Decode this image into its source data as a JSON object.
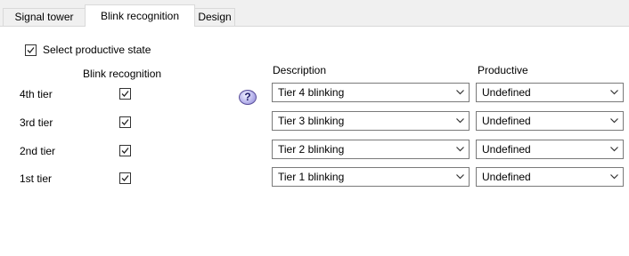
{
  "tabs": [
    {
      "label": "Signal tower"
    },
    {
      "label": "Blink recognition"
    },
    {
      "label": "Design"
    }
  ],
  "select_productive": {
    "label": "Select productive state",
    "checked": true
  },
  "columns": {
    "blink": "Blink recognition",
    "description": "Description",
    "productive": "Productive"
  },
  "rows": [
    {
      "label": "4th tier",
      "blink": true,
      "description": "Tier 4 blinking",
      "productive": "Undefined"
    },
    {
      "label": "3rd tier",
      "blink": true,
      "description": "Tier 3 blinking",
      "productive": "Undefined"
    },
    {
      "label": "2nd tier",
      "blink": true,
      "description": "Tier 2 blinking",
      "productive": "Undefined"
    },
    {
      "label": "1st tier",
      "blink": true,
      "description": "Tier 1 blinking",
      "productive": "Undefined"
    }
  ],
  "help_icon": {
    "glyph": "?"
  },
  "icons": {
    "checkmark": "checkmark-icon",
    "dropdown": "chevron-down-icon",
    "help": "help-icon"
  },
  "colors": {
    "panel_bg": "#ffffff",
    "window_bg": "#f0f0f0",
    "border": "#7a7a7a"
  }
}
